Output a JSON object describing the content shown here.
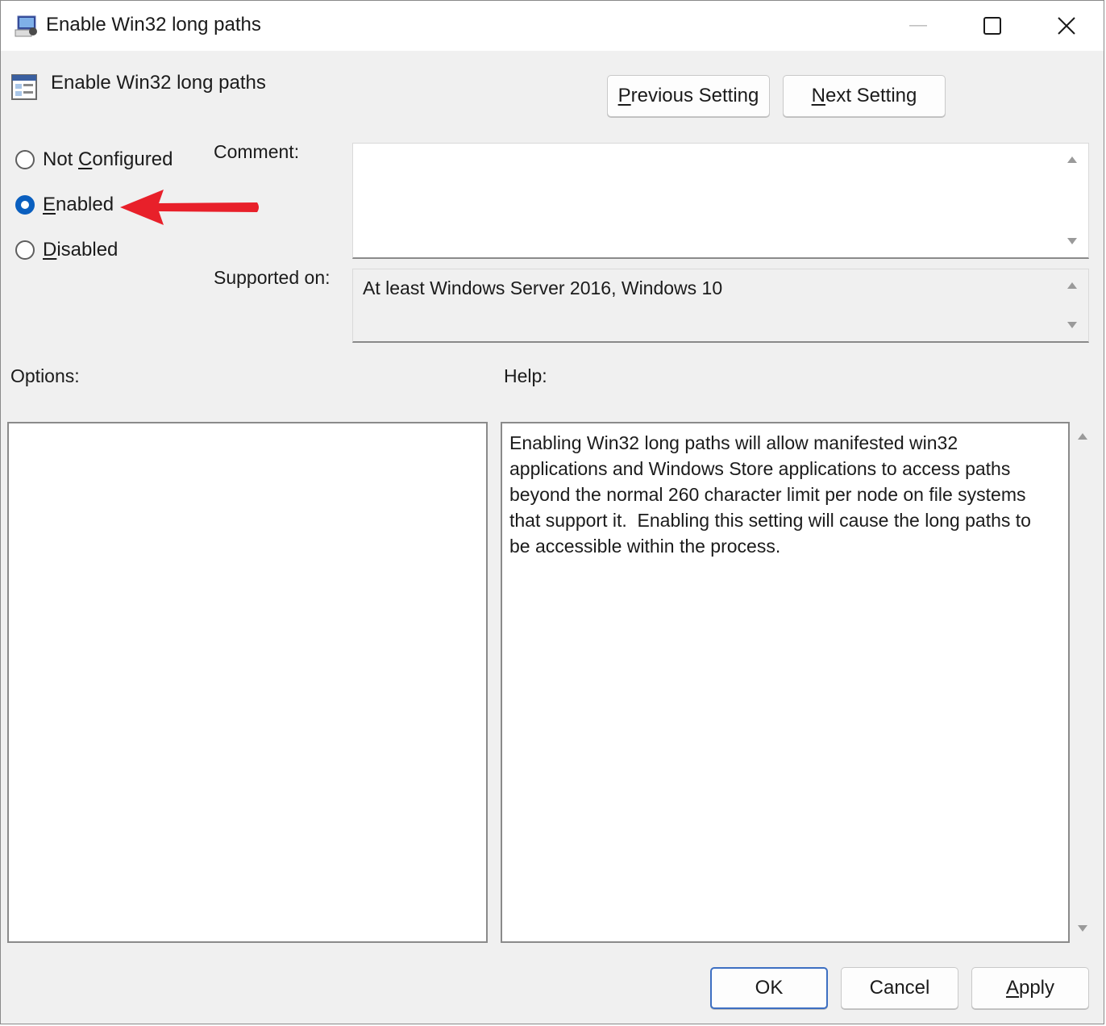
{
  "window": {
    "title": "Enable Win32 long paths",
    "icon": "group-policy-icon",
    "controls": [
      "minimize-icon",
      "maximize-icon",
      "close-icon"
    ]
  },
  "header": {
    "setting_name": "Enable Win32 long paths",
    "setting_icon": "policy-setting-icon",
    "prev_button": {
      "pre": "",
      "accel": "P",
      "post": "revious Setting"
    },
    "next_button": {
      "pre": "",
      "accel": "N",
      "post": "ext Setting"
    }
  },
  "state": {
    "options": [
      {
        "pre": "Not ",
        "accel": "C",
        "post": "onfigured",
        "selected": false
      },
      {
        "pre": "",
        "accel": "E",
        "post": "nabled",
        "selected": true
      },
      {
        "pre": "",
        "accel": "D",
        "post": "isabled",
        "selected": false
      }
    ]
  },
  "annotation": {
    "arrow_color": "#e8202a",
    "points_to": "Enabled"
  },
  "comment": {
    "label": "Comment:",
    "value": ""
  },
  "supported": {
    "label": "Supported on:",
    "value": "At least Windows Server 2016, Windows 10"
  },
  "options_panel": {
    "label": "Options:"
  },
  "help_panel": {
    "label": "Help:",
    "text": "Enabling Win32 long paths will allow manifested win32\napplications and Windows Store applications to access paths\nbeyond the normal 260 character limit per node on file systems\nthat support it.  Enabling this setting will cause the long paths to\nbe accessible within the process."
  },
  "footer": {
    "ok_label": "OK",
    "cancel_label": "Cancel",
    "apply_button": {
      "pre": "",
      "accel": "A",
      "post": "pply"
    }
  },
  "colors": {
    "accent": "#0a5fbf",
    "ok_border": "#3d6fc2",
    "dialog_bg": "#f0f0f0"
  }
}
